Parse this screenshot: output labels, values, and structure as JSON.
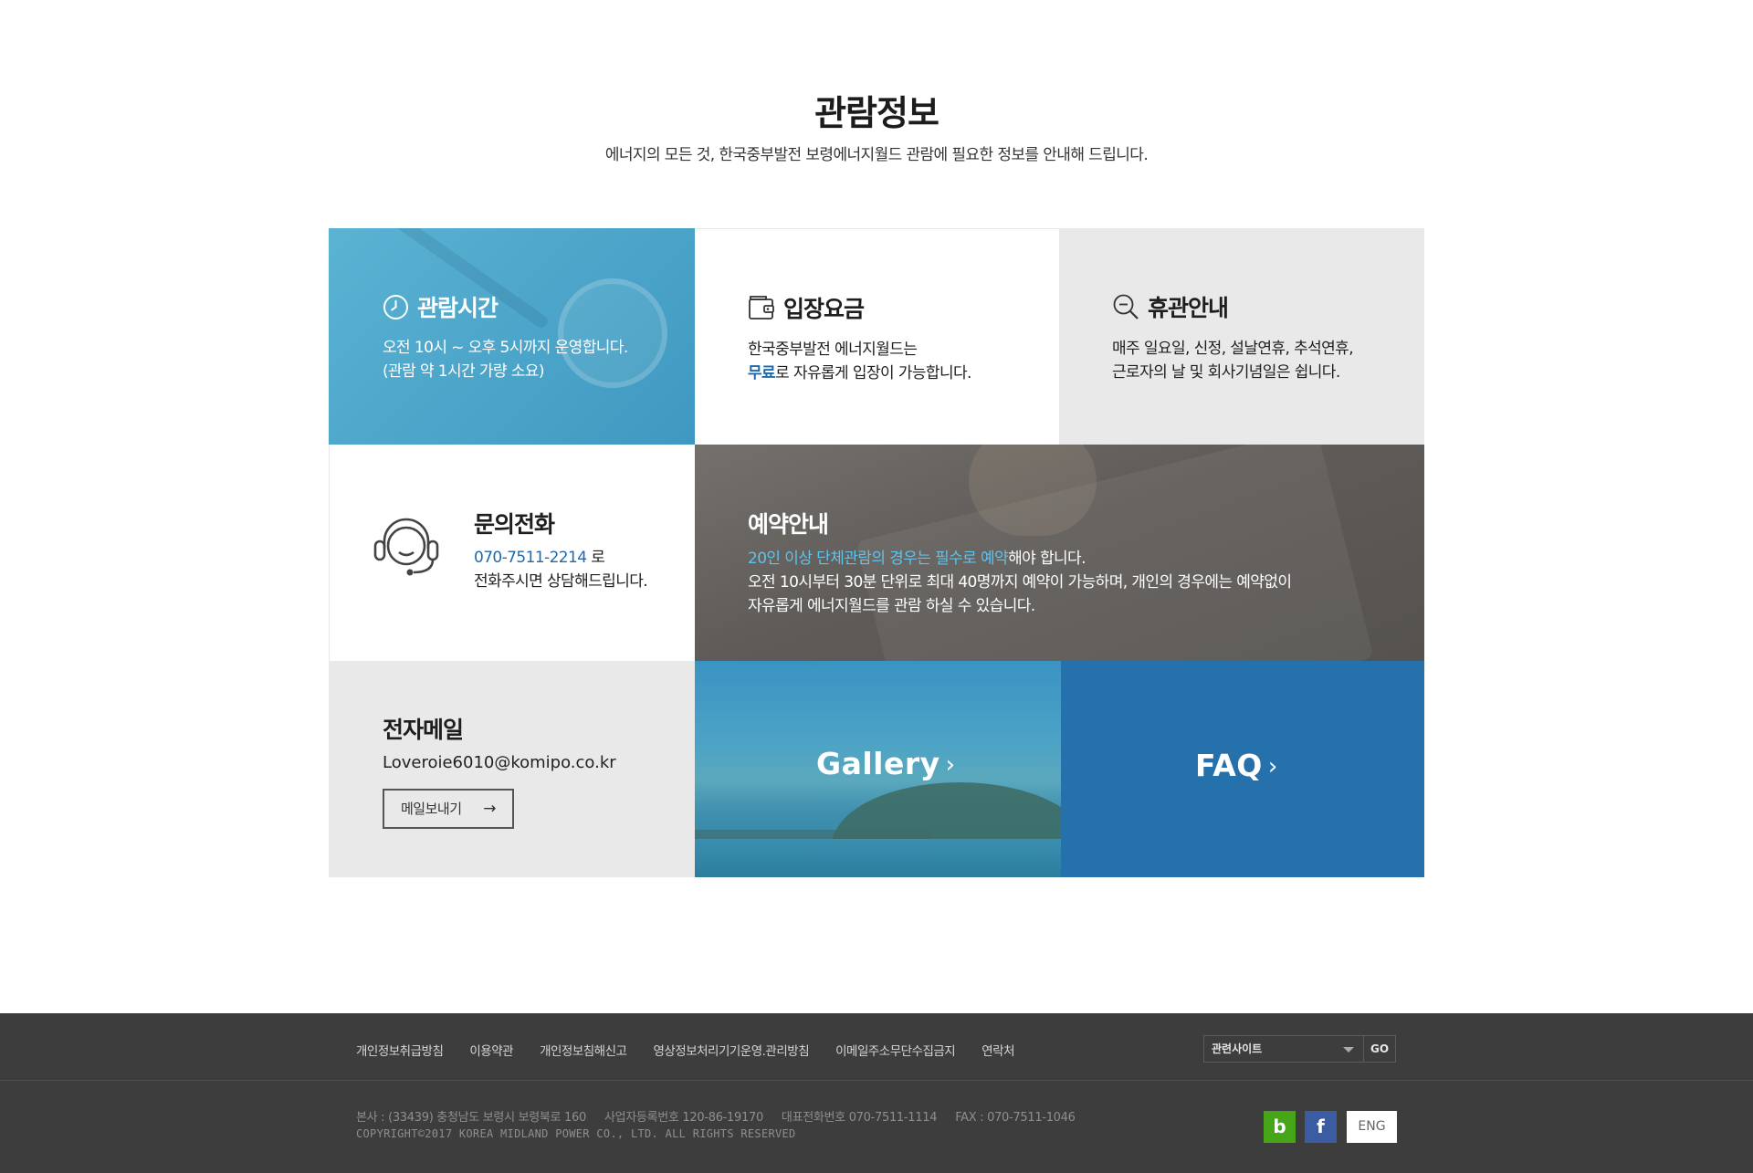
{
  "header": {
    "title": "관람정보",
    "subtitle": "에너지의 모든 것, 한국중부발전 보령에너지월드 관람에 필요한 정보를 안내해 드립니다."
  },
  "hours": {
    "title": "관람시간",
    "line1": "오전 10시 ~ 오후 5시까지 운영합니다.",
    "line2": "(관람 약 1시간 가량 소요)"
  },
  "fee": {
    "title": "입장요금",
    "line1": "한국중부발전 에너지월드는",
    "highlight": "무료",
    "line2_rest": "로 자유롭게 입장이 가능합니다."
  },
  "closed": {
    "title": "휴관안내",
    "line1": "매주 일요일, 신정, 설날연휴, 추석연휴,",
    "line2": "근로자의 날 및 회사기념일은 쉽니다."
  },
  "phone": {
    "title": "문의전화",
    "number": "070-7511-2214",
    "suffix": " 로",
    "line2": "전화주시면 상담해드립니다."
  },
  "reserve": {
    "title": "예약안내",
    "highlight": "20인 이상 단체관람의 경우는 필수로 예약",
    "line1_rest": "해야 합니다.",
    "line2": "오전 10시부터 30분 단위로 최대 40명까지 예약이 가능하며, 개인의 경우에는 예약없이",
    "line3": "자유롭게 에너지월드를 관람 하실 수 있습니다."
  },
  "email": {
    "title": "전자메일",
    "address": "Loveroie6010@komipo.co.kr",
    "button": "메일보내기",
    "button_arrow": "→"
  },
  "gallery": {
    "label": "Gallery",
    "chevron": "›"
  },
  "faq": {
    "label": "FAQ",
    "chevron": "›"
  },
  "footer": {
    "links": [
      "개인정보취급방침",
      "이용약관",
      "개인정보침해신고",
      "영상정보처리기기운영.관리방침",
      "이메일주소무단수집금지",
      "연락처"
    ],
    "related_select": "관련사이트",
    "go": "GO",
    "address": "본사 : (33439) 충청남도 보령시 보령북로 160",
    "bizno": "사업자등록번호 120-86-19170",
    "tel": "대표전화번호 070-7511-1114",
    "fax": "FAX : 070-7511-1046",
    "copyright": "COPYRIGHT©2017 KOREA MIDLAND POWER CO., LTD. ALL RIGHTS RESERVED",
    "blog_glyph": "b",
    "fb_glyph": "f",
    "eng": "ENG"
  },
  "colors": {
    "hours_bg": "#4aa3c8",
    "faq_bg": "#2571ab",
    "highlight_blue": "#1d6ab0",
    "highlight_light_blue": "#5cc4ee",
    "footer_bg": "#3e3d3e"
  }
}
